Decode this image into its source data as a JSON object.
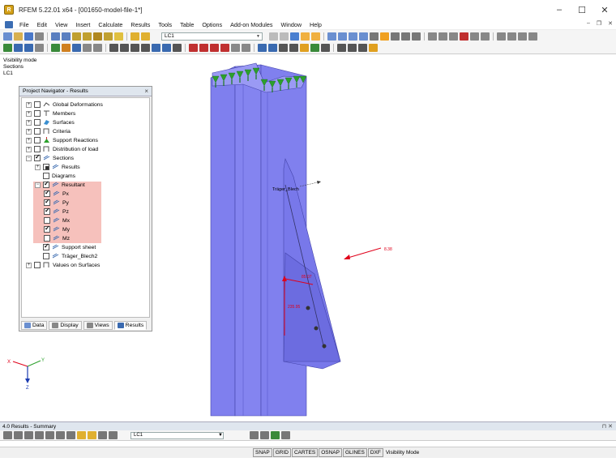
{
  "window": {
    "title": "RFEM 5.22.01 x64 - [001650-model-file-1*]",
    "minimize": "–",
    "maximize": "☐",
    "close": "✕"
  },
  "menu": {
    "items": [
      "File",
      "Edit",
      "View",
      "Insert",
      "Calculate",
      "Results",
      "Tools",
      "Table",
      "Options",
      "Add-on Modules",
      "Window",
      "Help"
    ],
    "doc_minimize": "–",
    "doc_restore": "❐",
    "doc_close": "✕"
  },
  "toolbar": {
    "load_case": "LC1"
  },
  "viewport": {
    "info_lines": [
      "Visibility mode",
      "Sections",
      "LC1"
    ],
    "section_label": "Träger_Blech",
    "value_load": "8.38",
    "value_vertical": "235.95",
    "value_small": "85.07",
    "axis_x": "X",
    "axis_y": "Y",
    "axis_z": "Z",
    "colors": {
      "structure": "#8080ee",
      "structure_dark": "#5a5acc",
      "supports": "#2ca02c",
      "results": "#e0001a"
    }
  },
  "navigator": {
    "title": "Project Navigator - Results",
    "close": "×",
    "items": [
      {
        "label": "Global Deformations",
        "expander": "+",
        "check": "off",
        "icon": "deformation-icon"
      },
      {
        "label": "Members",
        "expander": "+",
        "check": "off",
        "icon": "members-icon"
      },
      {
        "label": "Surfaces",
        "expander": "+",
        "check": "off",
        "icon": "surfaces-icon"
      },
      {
        "label": "Criteria",
        "expander": "+",
        "check": "off",
        "icon": "criteria-icon"
      },
      {
        "label": "Support Reactions",
        "expander": "+",
        "check": "off",
        "icon": "support-reactions-icon"
      },
      {
        "label": "Distribution of load",
        "expander": "+",
        "check": "off",
        "icon": "distribution-icon"
      },
      {
        "label": "Sections",
        "expander": "−",
        "check": "on",
        "icon": "sections-icon"
      },
      {
        "label": "Results",
        "expander": "+",
        "check": "partial",
        "icon": "results-icon"
      },
      {
        "label": "Diagrams",
        "expander": "",
        "check": "off",
        "icon": ""
      },
      {
        "label": "Resultant",
        "expander": "−",
        "check": "on",
        "icon": "resultant-icon"
      },
      {
        "label": "Px",
        "expander": "",
        "check": "on",
        "icon": "force-icon"
      },
      {
        "label": "Py",
        "expander": "",
        "check": "on",
        "icon": "force-icon"
      },
      {
        "label": "Pz",
        "expander": "",
        "check": "on",
        "icon": "force-icon"
      },
      {
        "label": "Mx",
        "expander": "",
        "check": "off",
        "icon": "moment-icon"
      },
      {
        "label": "My",
        "expander": "",
        "check": "on",
        "icon": "moment-icon"
      },
      {
        "label": "Mz",
        "expander": "",
        "check": "off",
        "icon": "moment-icon"
      },
      {
        "label": "Support sheet",
        "expander": "",
        "check": "on",
        "icon": "section-icon"
      },
      {
        "label": "Träger_Blech2",
        "expander": "",
        "check": "off",
        "icon": "section-icon"
      },
      {
        "label": "Values on Surfaces",
        "expander": "+",
        "check": "off",
        "icon": "values-icon"
      }
    ],
    "tabs": [
      "Data",
      "Display",
      "Views",
      "Results"
    ]
  },
  "bottom_panel": {
    "title": "4.0 Results - Summary",
    "ctrls": "⊓ ✕",
    "load_case": "LC1"
  },
  "statusbar": {
    "buttons": [
      "SNAP",
      "GRID",
      "CARTES",
      "OSNAP",
      "GLINES",
      "DXF"
    ],
    "mode": "Visibility Mode"
  }
}
